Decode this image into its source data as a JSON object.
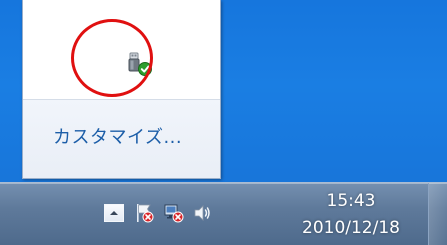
{
  "overflow_popup": {
    "customize_link": "カスタマイズ..."
  },
  "tray_icons": [
    {
      "icon": "usb-safely-remove-icon",
      "status": "ok"
    },
    {
      "icon": "action-center-flag-error-icon"
    },
    {
      "icon": "network-error-icon"
    },
    {
      "icon": "volume-icon"
    }
  ],
  "clock": {
    "time": "15:43",
    "date": "2010/12/18"
  },
  "colors": {
    "desktop": "#1676dd",
    "link": "#1c5ea8",
    "highlight": "#e01010",
    "taskbar": "#5f7a9b"
  }
}
